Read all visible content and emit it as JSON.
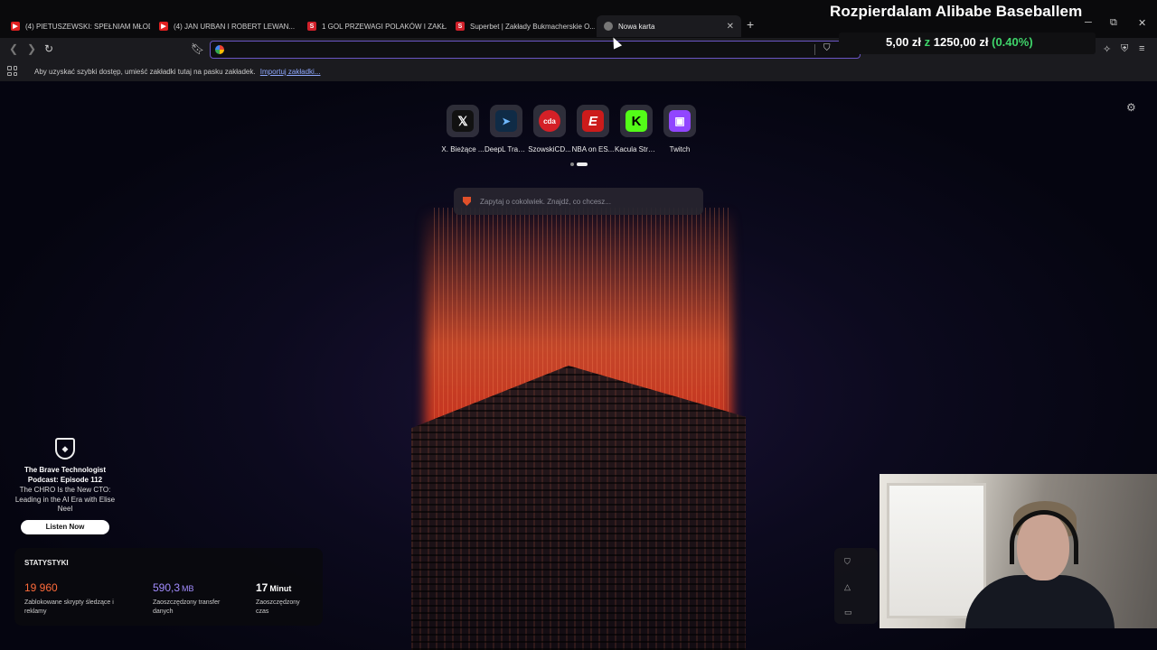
{
  "tabs": [
    {
      "title": "(4) PIETUSZEWSKI: SPEŁNIAM MŁOD...",
      "favicon_color": "#e02020",
      "favicon": "youtube-icon"
    },
    {
      "title": "(4) JAN URBAN I ROBERT LEWAN...",
      "favicon_color": "#e02020",
      "favicon": "youtube-icon"
    },
    {
      "title": "1 GOL PRZEWAGI POLAKÓW I ZAKŁA...",
      "favicon_color": "#d0202a",
      "favicon": "superbet-icon"
    },
    {
      "title": "Superbet | Zakłady Bukmacherskie O...",
      "favicon_color": "#d0202a",
      "favicon": "superbet-icon"
    },
    {
      "title": "Nowa karta",
      "favicon_color": "#888888",
      "favicon": "brave-icon",
      "active": true
    }
  ],
  "window_controls": {
    "new_tab": "+",
    "minimize": "─",
    "restore": "⧉",
    "close": "✕"
  },
  "address_bar": {
    "value": "",
    "placeholder": ""
  },
  "bookmarks_bar": {
    "hint": "Aby uzyskać szybki dostęp, umieść zakładki tutaj na pasku zakładek.",
    "import_link": "Importuj zakładki..."
  },
  "shortcuts": [
    {
      "label": "X. Bieżące ...",
      "glyph": "𝕏",
      "color": "#111111"
    },
    {
      "label": "DeepL Tran...",
      "glyph": "➤",
      "color": "#0f2b46"
    },
    {
      "label": "SzowskiCD...",
      "glyph": "cda",
      "color": "#d42027"
    },
    {
      "label": "NBA on ES...",
      "glyph": "E",
      "color": "#cc1b1b"
    },
    {
      "label": "Kacula Stre...",
      "glyph": "K",
      "color": "#53fc18"
    },
    {
      "label": "Twitch",
      "glyph": "▣",
      "color": "#9146ff"
    }
  ],
  "search": {
    "placeholder": "Zapytaj o cokolwiek. Znajdź, co chcesz..."
  },
  "promo": {
    "title": "The Brave Technologist Podcast: Episode 112",
    "description": "The CHRO Is the New CTO: Leading in the AI Era with Elise Neel",
    "button": "Listen Now"
  },
  "stats": {
    "header": "STATYSTYKI",
    "blocked": {
      "value": "19 960",
      "caption": "Zablokowane skrypty śledzące i reklamy"
    },
    "bandwidth": {
      "value": "590,3",
      "unit": "MB",
      "caption": "Zaoszczędzony transfer danych"
    },
    "time": {
      "value": "17",
      "unit": "Minut",
      "caption": "Zaoszczędzony czas"
    }
  },
  "overlay": {
    "stream_title": "Rozpierdalam Alibabe Baseballem",
    "money_current": "5,00 zł",
    "money_sep": "z",
    "money_goal": "1250,00 zł",
    "money_pct": "(0.40%)"
  }
}
